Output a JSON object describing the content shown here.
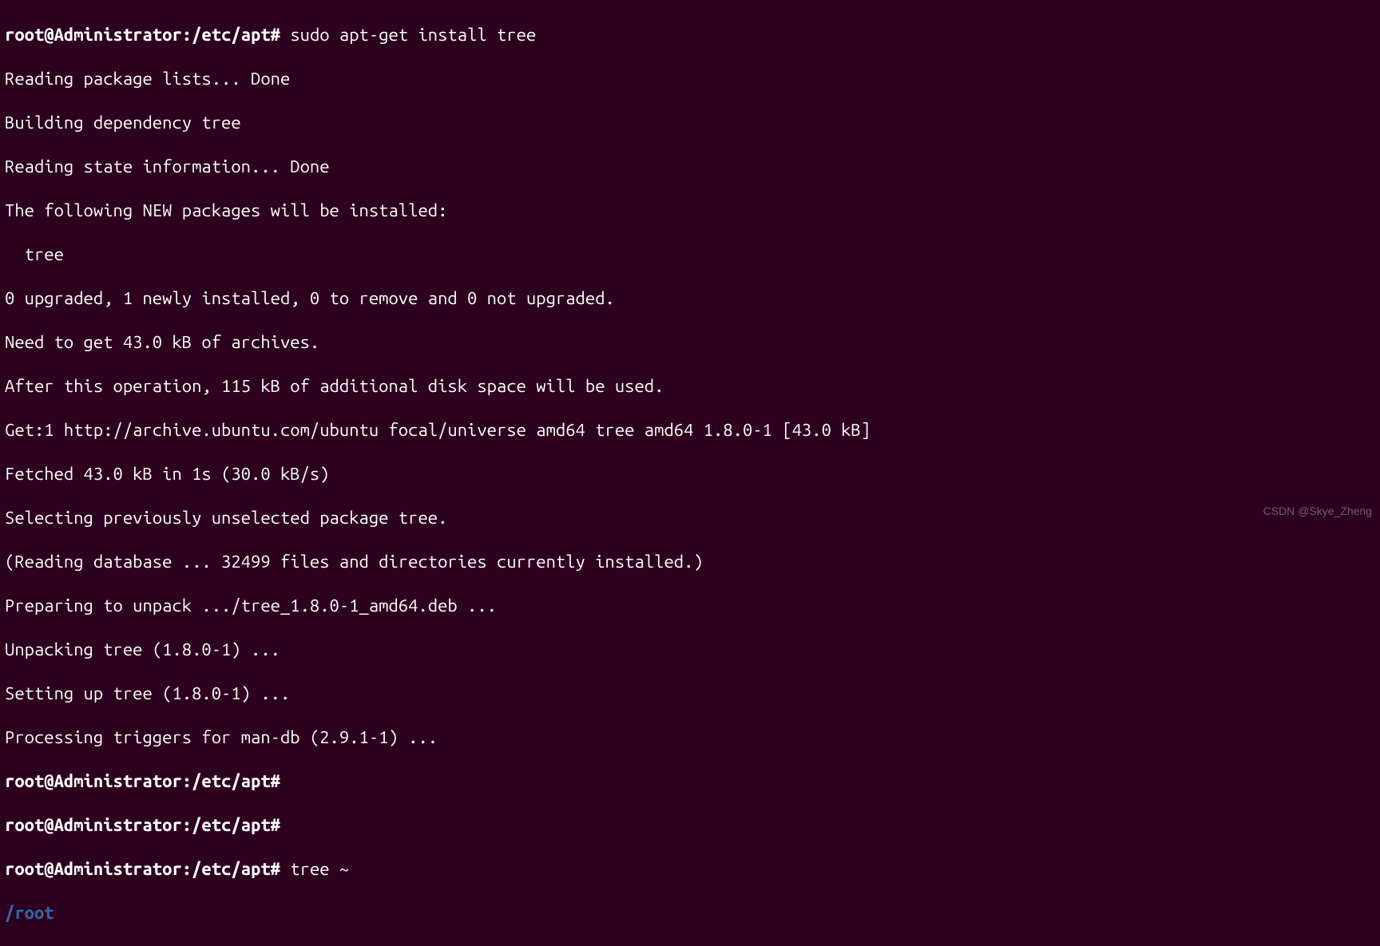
{
  "prompt1": {
    "user_host": "root@Administrator",
    "sep1": ":",
    "path": "/etc/apt",
    "hash": "#",
    "command": "sudo apt-get install tree"
  },
  "output_lines": [
    "Reading package lists... Done",
    "Building dependency tree",
    "Reading state information... Done",
    "The following NEW packages will be installed:",
    "  tree",
    "0 upgraded, 1 newly installed, 0 to remove and 0 not upgraded.",
    "Need to get 43.0 kB of archives.",
    "After this operation, 115 kB of additional disk space will be used.",
    "Get:1 http://archive.ubuntu.com/ubuntu focal/universe amd64 tree amd64 1.8.0-1 [43.0 kB]",
    "Fetched 43.0 kB in 1s (30.0 kB/s)",
    "Selecting previously unselected package tree.",
    "(Reading database ... 32499 files and directories currently installed.)",
    "Preparing to unpack .../tree_1.8.0-1_amd64.deb ...",
    "Unpacking tree (1.8.0-1) ...",
    "Setting up tree (1.8.0-1) ...",
    "Processing triggers for man-db (2.9.1-1) ..."
  ],
  "prompt2": {
    "user_host": "root@Administrator",
    "sep1": ":",
    "path": "/etc/apt",
    "hash": "#",
    "command": ""
  },
  "prompt3": {
    "user_host": "root@Administrator",
    "sep1": ":",
    "path": "/etc/apt",
    "hash": "#",
    "command": ""
  },
  "prompt4": {
    "user_host": "root@Administrator",
    "sep1": ":",
    "path": "/etc/apt",
    "hash": "#",
    "command": "tree ~"
  },
  "tree_root": "/root",
  "watermark": "CSDN @Skye_Zheng"
}
